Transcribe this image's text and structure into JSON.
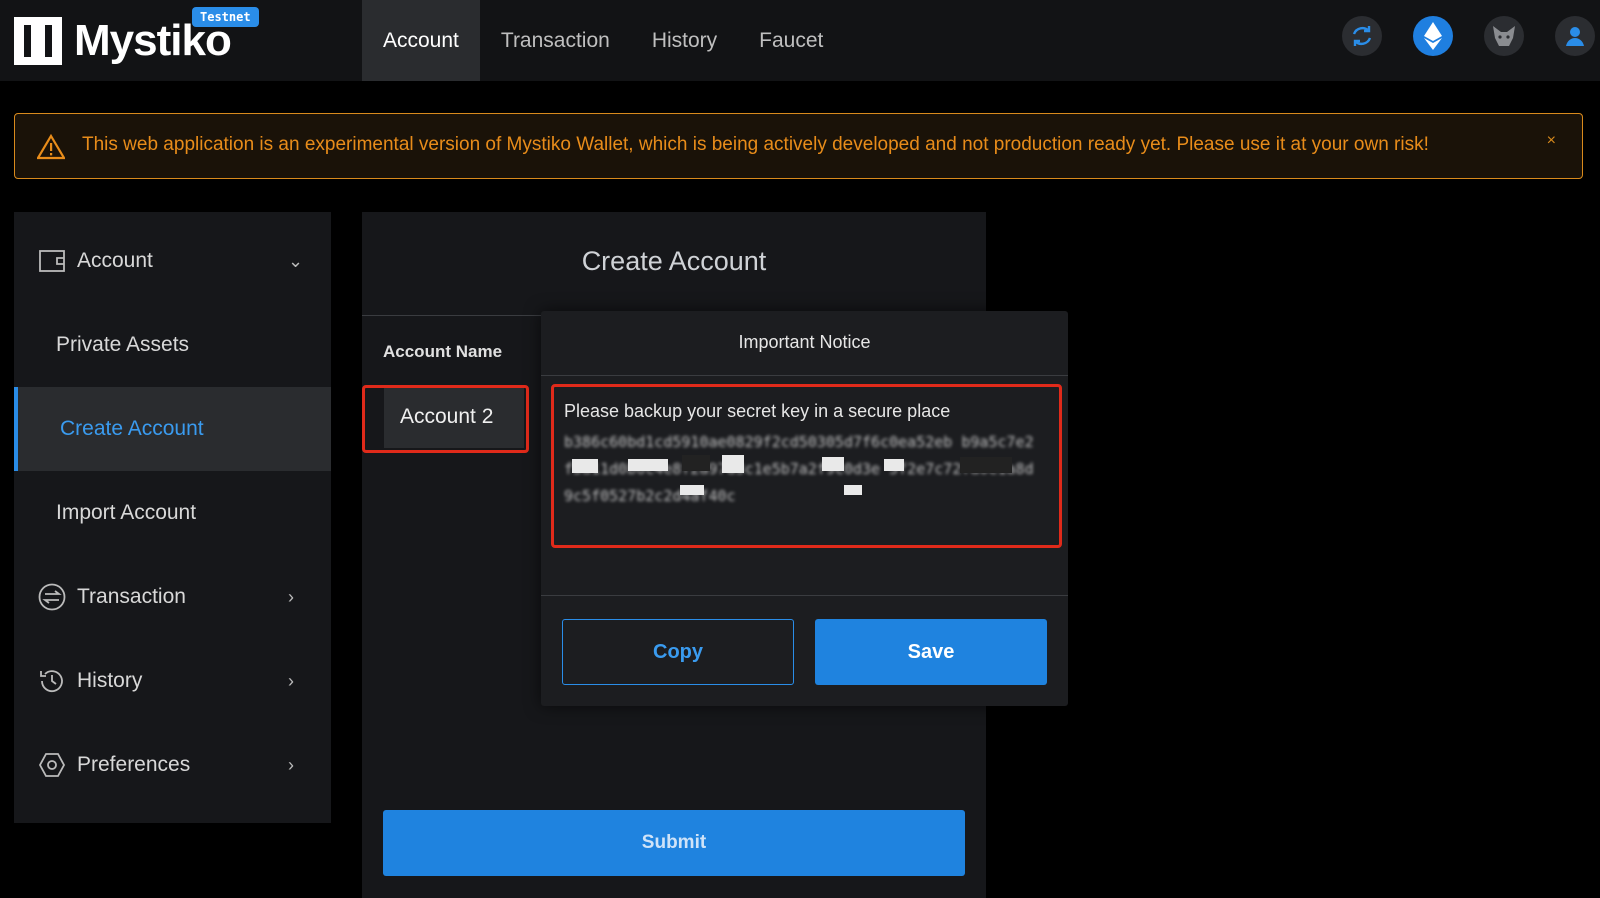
{
  "app": {
    "brand": "Mystiko",
    "badge": "Testnet"
  },
  "nav": {
    "tabs": [
      {
        "label": "Account"
      },
      {
        "label": "Transaction"
      },
      {
        "label": "History"
      },
      {
        "label": "Faucet"
      }
    ],
    "active": "Account",
    "icons": [
      "refresh-icon",
      "ethereum-icon",
      "metamask-icon",
      "user-icon"
    ]
  },
  "banner": {
    "text": "This web application is an experimental version of Mystiko Wallet, which is being actively developed and not production ready yet. Please use it at your own risk!",
    "close": "×",
    "color": "#e88c1a"
  },
  "sidebar": {
    "items": [
      {
        "label": "Account",
        "icon": "wallet-icon",
        "expanded": true
      },
      {
        "label": "Private Assets"
      },
      {
        "label": "Create Account",
        "active": true
      },
      {
        "label": "Import Account"
      },
      {
        "label": "Transaction",
        "icon": "transaction-icon"
      },
      {
        "label": "History",
        "icon": "history-icon"
      },
      {
        "label": "Preferences",
        "icon": "settings-icon"
      }
    ]
  },
  "panel": {
    "title": "Create Account",
    "field_label": "Account Name",
    "account_name": "Account 2",
    "submit_label": "Submit"
  },
  "modal": {
    "title": "Important Notice",
    "message": "Please backup your secret key in a secure place",
    "secret_key": "b386c60bd1cd5910ae0829f2cd50305d7f6c0ea52eb b9a5c7e2f3a11d0b6c4e8f2a97d3c1e5b7a2f9c0d3e 5f2e7c72fa0e1a8d9c5f0527b2c2d4af40c",
    "copy_label": "Copy",
    "save_label": "Save",
    "accent": "#1f83df"
  }
}
